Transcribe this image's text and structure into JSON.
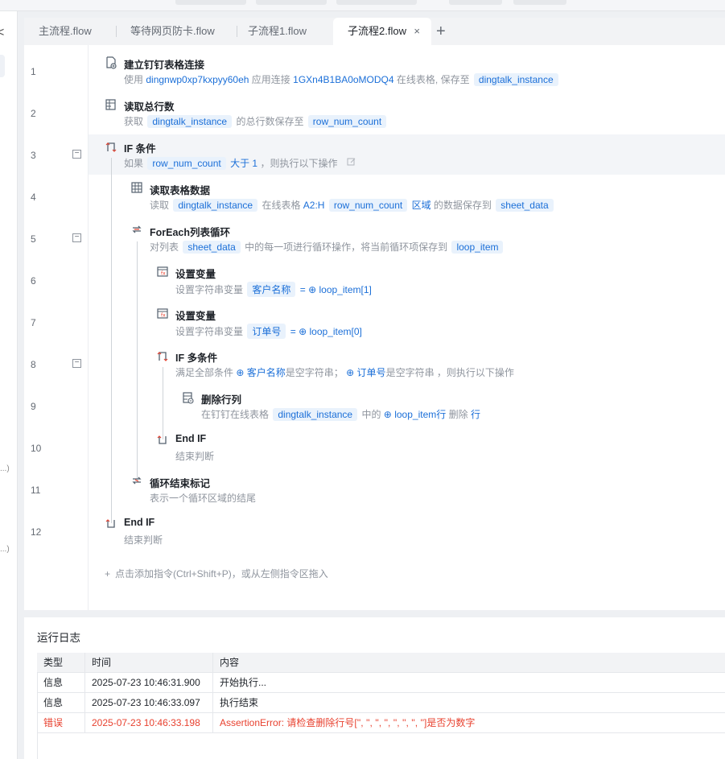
{
  "tabs": {
    "items": [
      {
        "label": "主流程.flow"
      },
      {
        "label": "等待网页防卡.flow"
      },
      {
        "label": "子流程1.flow"
      },
      {
        "label": "子流程2.flow"
      }
    ],
    "close_glyph": "×",
    "add_glyph": "+"
  },
  "left_panel": {
    "close_glyph": "<",
    "dots1": "...)",
    "dots2": "...)"
  },
  "editor": {
    "lines": [
      {
        "n": "1",
        "title": "建立钉钉表格连接",
        "icon": "spreadsheet-connect-icon",
        "d": {
          "t1": "使用",
          "v1": "dingnwp0xp7kxpyy60eh",
          "t2": "应用连接",
          "v2": "1GXn4B1BA0oMODQ4",
          "t3": "在线表格, 保存至",
          "chip": "dingtalk_instance"
        }
      },
      {
        "n": "2",
        "title": "读取总行数",
        "icon": "table-rows-icon",
        "d": {
          "t1": "获取",
          "chip1": "dingtalk_instance",
          "t2": "的总行数保存至",
          "chip2": "row_num_count"
        }
      },
      {
        "n": "3",
        "title": "IF 条件",
        "icon": "if-branch-icon",
        "d": {
          "t1": "如果",
          "chip": "row_num_count",
          "v1": "大于 1",
          "t2": "，则执行以下操作"
        }
      },
      {
        "n": "4",
        "title": "读取表格数据",
        "icon": "grid-icon",
        "d": {
          "t1": "读取",
          "chip1": "dingtalk_instance",
          "t2": "在线表格",
          "v1": "A2:H",
          "chip2": "row_num_count",
          "v2": "区域",
          "t3": "的数据保存到",
          "chip3": "sheet_data"
        }
      },
      {
        "n": "5",
        "title": "ForEach列表循环",
        "icon": "loop-icon",
        "d": {
          "t1": "对列表",
          "chip1": "sheet_data",
          "t2": "中的每一项进行循环操作，将当前循环项保存到",
          "chip2": "loop_item"
        }
      },
      {
        "n": "6",
        "title": "设置变量",
        "icon": "variable-icon",
        "d": {
          "t1": "设置字符串变量",
          "chip": "客户名称",
          "eq": "=",
          "v1": "loop_item[1]"
        }
      },
      {
        "n": "7",
        "title": "设置变量",
        "icon": "variable-icon",
        "d": {
          "t1": "设置字符串变量",
          "chip": "订单号",
          "eq": "=",
          "v1": "loop_item[0]"
        }
      },
      {
        "n": "8",
        "title": "IF 多条件",
        "icon": "if-branch-icon",
        "d": {
          "t1": "满足全部条件",
          "v1": "客户名称",
          "t2": "是空字符串；",
          "v2": "订单号",
          "t3": "是空字符串",
          "t4": "，则执行以下操作"
        }
      },
      {
        "n": "9",
        "title": "删除行列",
        "icon": "delete-rows-icon",
        "d": {
          "t1": "在钉钉在线表格",
          "chip": "dingtalk_instance",
          "t2": "中的",
          "v1": "loop_item行",
          "t3": "删除",
          "v2": "行"
        }
      },
      {
        "n": "10",
        "title": "End IF",
        "icon": "end-if-icon",
        "d": {
          "t1": "结束判断"
        }
      },
      {
        "n": "11",
        "title": "循环结束标记",
        "icon": "loop-end-icon",
        "d": {
          "t1": "表示一个循环区域的结尾"
        }
      },
      {
        "n": "12",
        "title": "End IF",
        "icon": "end-if-icon",
        "d": {
          "t1": "结束判断"
        }
      }
    ],
    "fold_glyph": "−",
    "add_hint": "点击添加指令(Ctrl+Shift+P)，或从左侧指令区拖入",
    "add_hint_icon": "+"
  },
  "log": {
    "title": "运行日志",
    "headers": {
      "type": "类型",
      "time": "时间",
      "content": "内容"
    },
    "rows": [
      {
        "type": "信息",
        "time": "2025-07-23 10:46:31.900",
        "content": "开始执行..."
      },
      {
        "type": "信息",
        "time": "2025-07-23 10:46:33.097",
        "content": "执行结束"
      },
      {
        "type": "错误",
        "time": "2025-07-23 10:46:33.198",
        "content": "AssertionError: 请检查删除行号['', '', '', '', '', '', '', '']是否为数字"
      }
    ],
    "colors": {
      "error": "#e8412f",
      "accent": "#1b6fd8",
      "chip_bg": "#e9f2fc"
    }
  }
}
